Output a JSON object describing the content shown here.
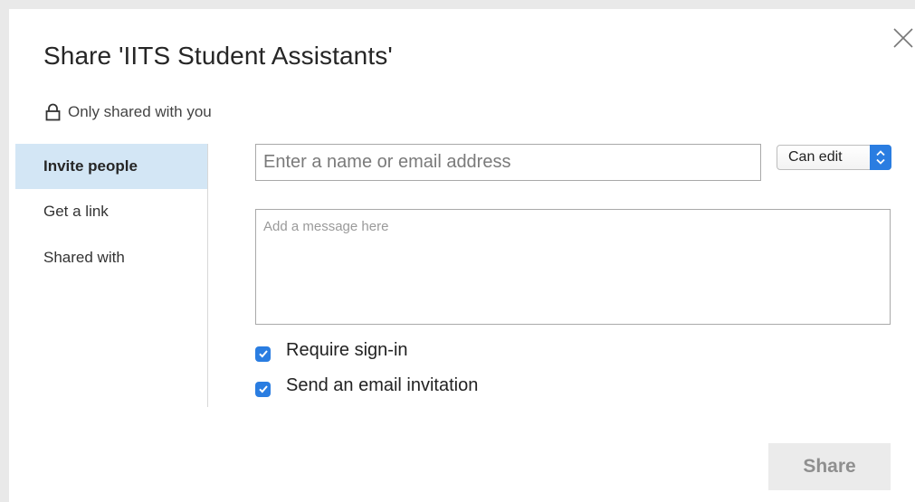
{
  "dialog": {
    "title": "Share 'IITS Student Assistants'",
    "shared_status": "Only shared with you",
    "close_icon": "close-icon",
    "lock_icon": "lock-icon"
  },
  "nav": {
    "items": [
      {
        "label": "Invite people",
        "active": true
      },
      {
        "label": "Get a link",
        "active": false
      },
      {
        "label": "Shared with",
        "active": false
      }
    ]
  },
  "invite": {
    "name_placeholder": "Enter a name or email address",
    "name_value": "",
    "permission": "Can edit",
    "message_placeholder": "Add a message here",
    "message_value": "",
    "options": [
      {
        "label": "Require sign-in",
        "checked": true
      },
      {
        "label": "Send an email invitation",
        "checked": true
      }
    ],
    "share_label": "Share"
  },
  "colors": {
    "accent": "#2a7de1",
    "nav_active_bg": "#d3e6f5",
    "share_disabled_bg": "#ebebeb"
  }
}
